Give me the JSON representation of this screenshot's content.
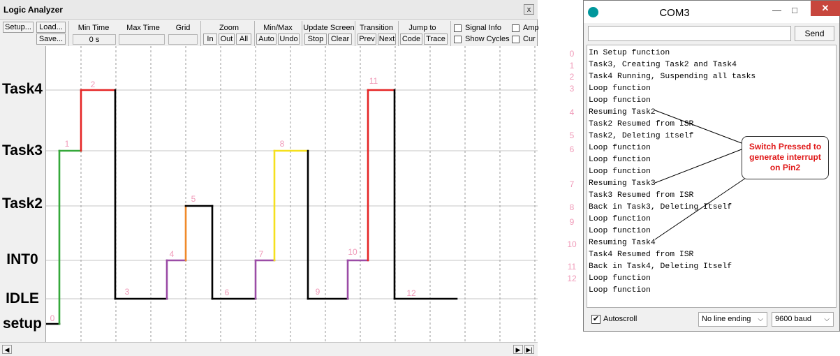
{
  "logic_analyzer": {
    "title": "Logic Analyzer",
    "close_label": "x",
    "toolbar": {
      "setup_label": "Setup...",
      "load_label": "Load...",
      "save_label": "Save...",
      "min_time_label": "Min Time",
      "min_time_value": "0 s",
      "max_time_label": "Max Time",
      "grid_label": "Grid",
      "zoom_label": "Zoom",
      "zoom_in": "In",
      "zoom_out": "Out",
      "zoom_all": "All",
      "minmax_label": "Min/Max",
      "minmax_auto": "Auto",
      "minmax_undo": "Undo",
      "update_label": "Update Screen",
      "update_stop": "Stop",
      "update_clear": "Clear",
      "transition_label": "Transition",
      "transition_prev": "Prev",
      "transition_next": "Next",
      "jump_label": "Jump to",
      "jump_code": "Code",
      "jump_trace": "Trace",
      "signal_info_label": "Signal Info",
      "show_cycles_label": "Show Cycles",
      "amp_label": "Amp",
      "cur_label": "Cur"
    },
    "signals": [
      "Task4",
      "Task3",
      "Task2",
      "INT0",
      "IDLE",
      "setup"
    ],
    "trace_labels": [
      "0",
      "1",
      "2",
      "3",
      "4",
      "5",
      "6",
      "7",
      "8",
      "9",
      "10",
      "11",
      "12"
    ],
    "colors": {
      "setup": "#000000",
      "task3_run": "#35a83a",
      "task4_run": "#e52424",
      "idle": "#000000",
      "int0": "#9b4ca6",
      "task2_run": "#f08a2a",
      "task3_resume": "#f5e01d",
      "label": "#f09ab8",
      "grid": "#c4c4c4"
    }
  },
  "serial_monitor": {
    "title": "COM3",
    "minimize": "—",
    "maximize": "□",
    "close": "✕",
    "send_label": "Send",
    "lines": [
      "In Setup function",
      "Task3, Creating Task2 and Task4",
      "Task4 Running, Suspending all tasks",
      "Loop function",
      "Loop function",
      "Resuming Task2",
      "Task2 Resumed from ISR",
      "Task2, Deleting itself",
      "Loop function",
      "Loop function",
      "Loop function",
      "Resuming Task3",
      "Task3 Resumed from ISR",
      "Back in Task3, Deleting Itself",
      "Loop function",
      "Loop function",
      "Resuming Task4",
      "Task4 Resumed from ISR",
      "Back in Task4, Deleting Itself",
      "Loop function",
      "Loop function"
    ],
    "autoscroll_label": "Autoscroll",
    "autoscroll_checked": "✔",
    "line_ending": "No line ending",
    "baud": "9600 baud"
  },
  "annotations": {
    "line_numbers": [
      "0",
      "1",
      "2",
      "3",
      "4",
      "5",
      "6",
      "7",
      "8",
      "9",
      "10",
      "11",
      "12"
    ],
    "callout_text": [
      "Switch Pressed to",
      "generate interrupt",
      "on Pin2"
    ]
  }
}
